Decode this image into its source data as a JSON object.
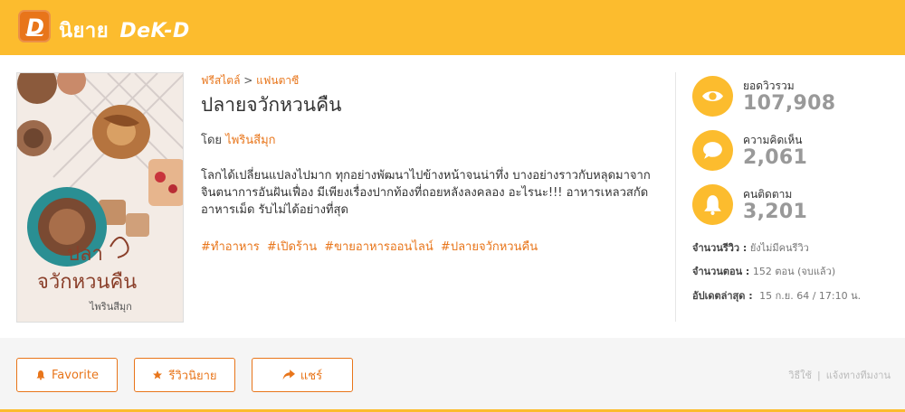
{
  "header": {
    "logo_letter": "D",
    "brand_text": "นิยาย",
    "brand_sub": "DeK-D",
    "colors": {
      "bar": "#fcbc2e",
      "accent": "#e8751a"
    }
  },
  "cover": {
    "title_line1": "ปลา",
    "title_line2": "จวักหวนคืน",
    "author": "ไพรินสีมุก"
  },
  "novel": {
    "breadcrumb_1": "ฟรีสไตล์",
    "breadcrumb_sep": ">",
    "breadcrumb_2": "แฟนตาซี",
    "title": "ปลายจวักหวนคืน",
    "by_label": "โดย",
    "author": "ไพรินสีมุก",
    "description": "โลกได้เปลี่ยนแปลงไปมาก ทุกอย่างพัฒนาไปข้างหน้าจนน่าทึ่ง บางอย่างราวกับหลุดมาจากจินตนาการอันฝันเฟื่อง มีเพียงเรื่องปากท้องที่ถอยหลังลงคลอง อะไรนะ!!! อาหารเหลวสกัด อาหารเม็ด รับไม่ได้อย่างที่สุด",
    "tags": [
      "#ทำอาหาร",
      "#เปิดร้าน",
      "#ขายอาหารออนไลน์",
      "#ปลายจวักหวนคืน"
    ]
  },
  "stats": {
    "views_label": "ยอดวิวรวม",
    "views_value": "107,908",
    "comments_label": "ความคิดเห็น",
    "comments_value": "2,061",
    "followers_label": "คนติดตาม",
    "followers_value": "3,201",
    "views_icon": "eye-icon",
    "comments_icon": "speech-bubble-icon",
    "followers_icon": "bell-icon"
  },
  "meta": {
    "reviews_label": "จำนวนรีวิว :",
    "reviews_value": "ยังไม่มีคนรีวิว",
    "episodes_label": "จำนวนตอน :",
    "episodes_value": "152 ตอน (จบแล้ว)",
    "updated_label": "อัปเดตล่าสุด :",
    "updated_value": "15 ก.ย. 64 / 17:10 น."
  },
  "actions": {
    "favorite_label": "Favorite",
    "review_label": "รีวิวนิยาย",
    "share_label": "แชร์",
    "help_link": "วิธีใช้",
    "link_sep": "|",
    "report_link": "แจ้งทางทีมงาน"
  }
}
